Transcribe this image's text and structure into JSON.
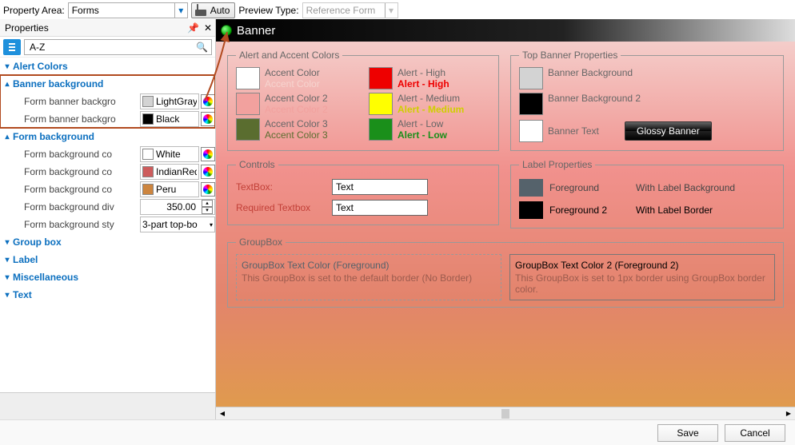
{
  "toolbar": {
    "property_area_label": "Property Area:",
    "property_area_value": "Forms",
    "auto_label": "Auto",
    "preview_type_label": "Preview Type:",
    "preview_type_value": "Reference Form"
  },
  "panel": {
    "title": "Properties",
    "az_label": "A-Z",
    "search_value": ""
  },
  "cats": {
    "alert": "Alert Colors",
    "banner": "Banner background",
    "banner_row1": "Form banner backgro",
    "banner_val1": "LightGray",
    "banner_row2": "Form banner backgro",
    "banner_val2": "Black",
    "formbg": "Form background",
    "f_row1": "Form background co",
    "f_val1": "White",
    "f_row2": "Form background co",
    "f_val2": "IndianRed",
    "f_row3": "Form background co",
    "f_val3": "Peru",
    "f_row4": "Form background div",
    "f_val4": "350.00",
    "f_row5": "Form background sty",
    "f_val5": "3-part top-bo",
    "groupbox": "Group box",
    "label": "Label",
    "misc": "Miscellaneous",
    "text": "Text"
  },
  "preview": {
    "banner_text": "Banner",
    "fs_alert": "Alert and Accent Colors",
    "acc1a": "Accent Color",
    "acc1b": "Accent Color",
    "acc2a": "Accent Color 2",
    "acc2b": "Accent Color 2",
    "acc3a": "Accent Color 3",
    "acc3b": "Accent Color 3",
    "ah1": "Alert - High",
    "ah2": "Alert - High",
    "am1": "Alert - Medium",
    "am2": "Alert - Medium",
    "al1": "Alert - Low",
    "al2": "Alert - Low",
    "fs_top": "Top Banner Properties",
    "tb1": "Banner Background",
    "tb2": "Banner Background 2",
    "tb3": "Banner Text",
    "glossy": "Glossy Banner",
    "fs_ctl": "Controls",
    "ctl_tb": "TextBox:",
    "ctl_req": "Required Textbox",
    "ctl_val": "Text",
    "fs_label": "Label Properties",
    "lp_fg": "Foreground",
    "lp_fg2": "Foreground 2",
    "lp_wlbg": "With Label Background",
    "lp_wlbd": "With Label Border",
    "fs_gb": "GroupBox",
    "gb_t1": "GroupBox Text Color (Foreground)",
    "gb_d1": "This GroupBox is set to the default border (No Border)",
    "gb_t2": "GroupBox Text Color 2 (Foreground 2)",
    "gb_d2": "This GroupBox is set to 1px border using GroupBox border color."
  },
  "footer": {
    "save": "Save",
    "cancel": "Cancel"
  }
}
